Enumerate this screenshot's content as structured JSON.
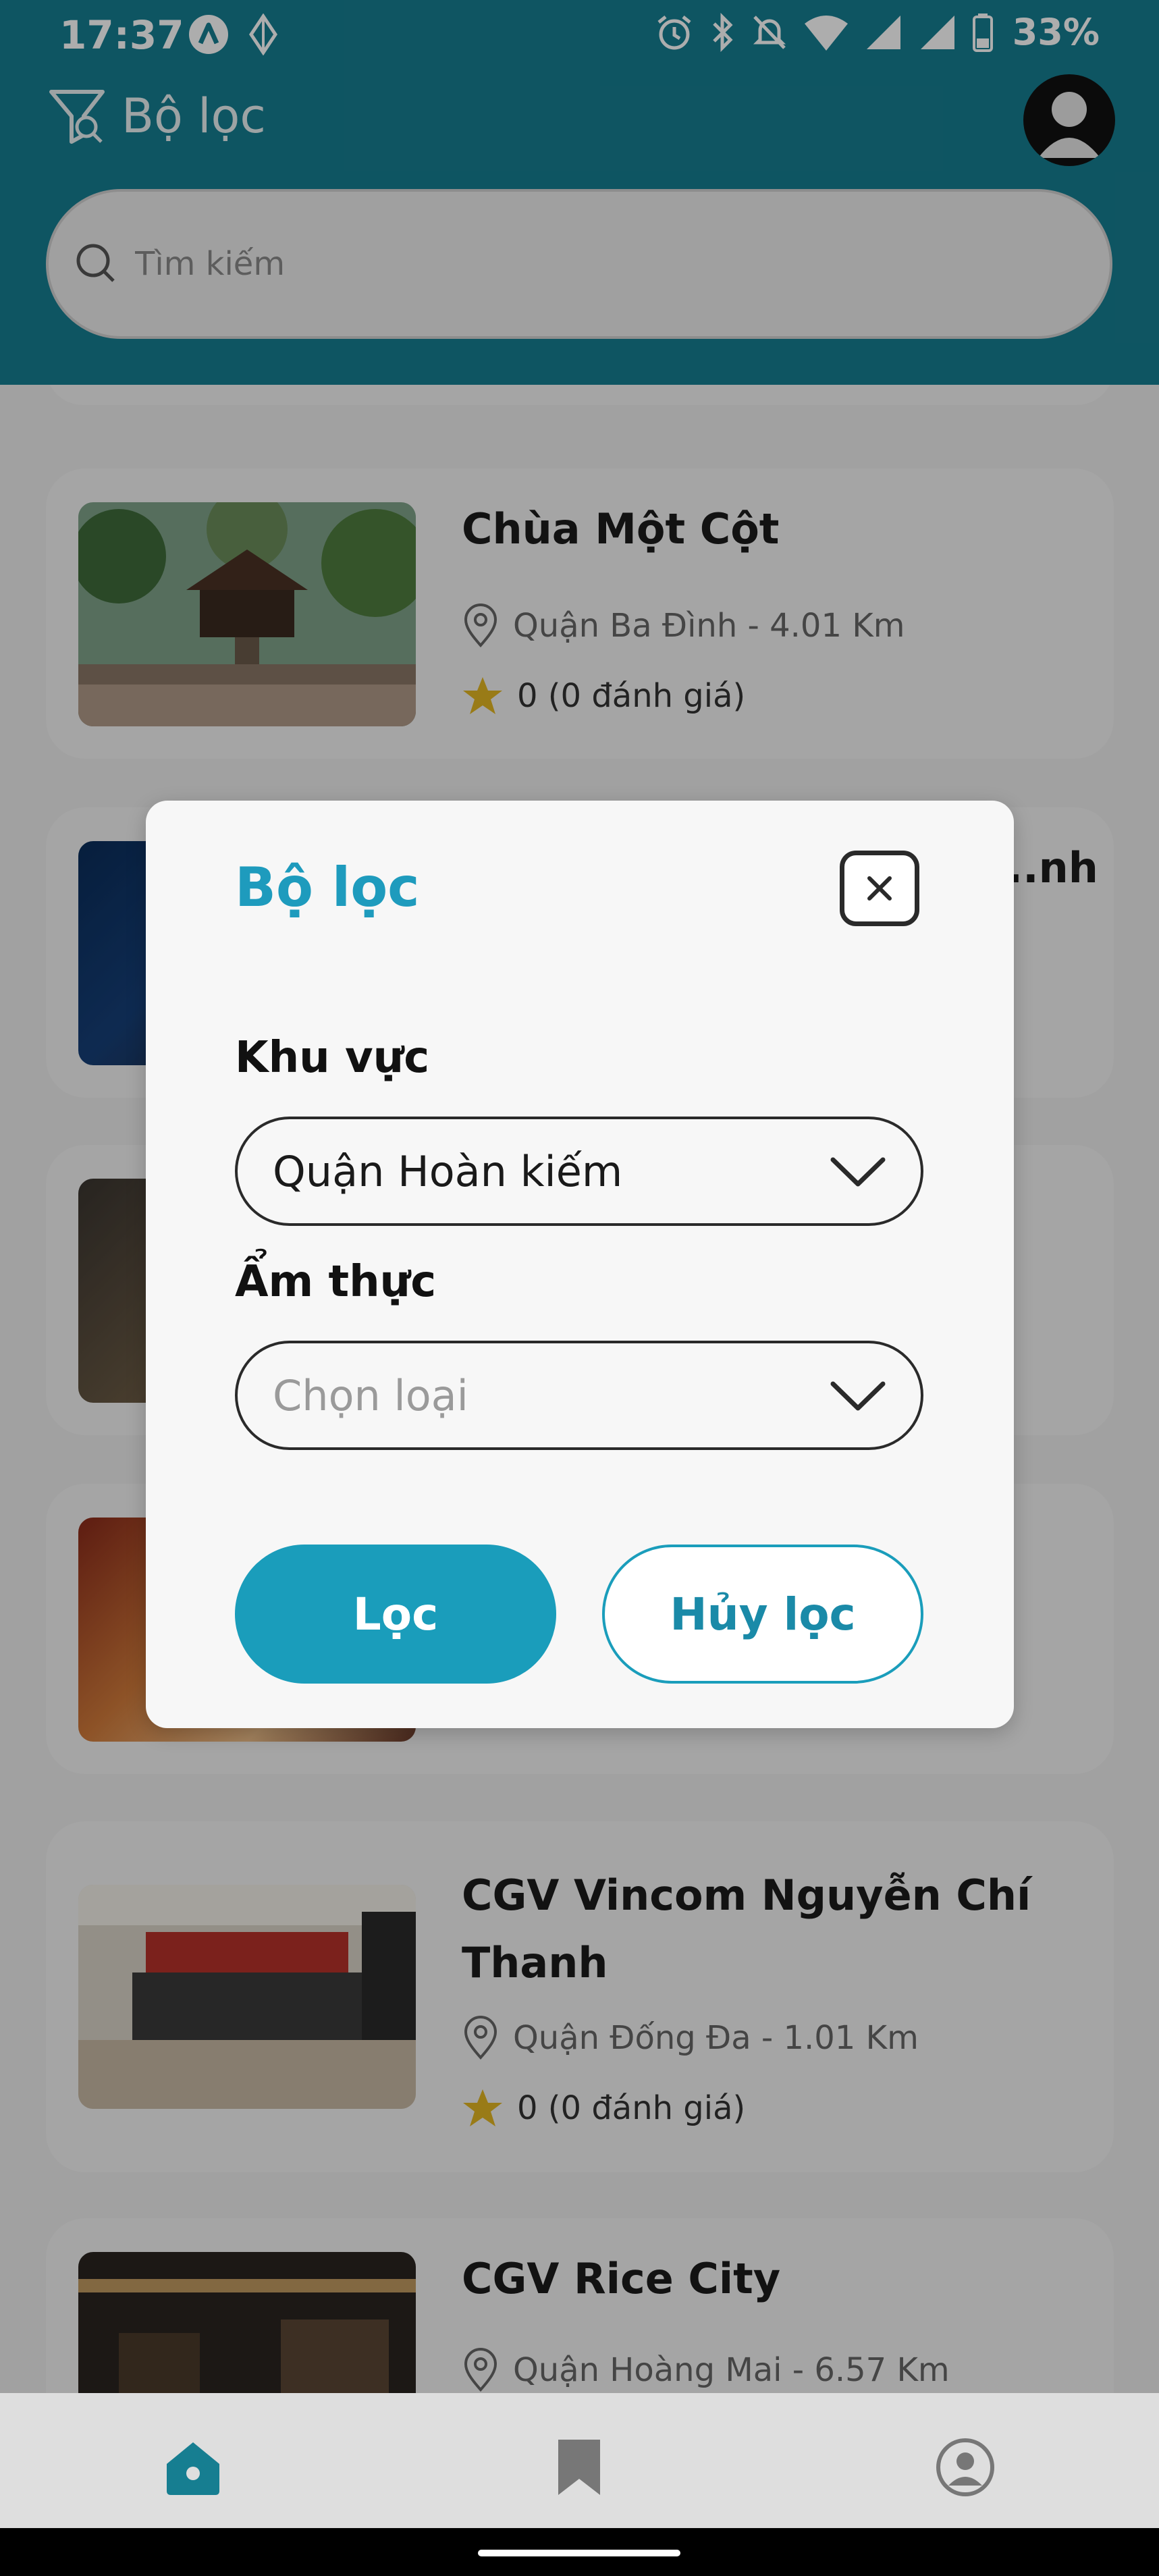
{
  "status_bar": {
    "time": "17:37",
    "battery": "33%",
    "icons": [
      "app-a-icon",
      "drive-icon",
      "alarm-icon",
      "bluetooth-icon",
      "mute-icon",
      "wifi-icon",
      "signal-icon",
      "signal-icon",
      "battery-icon"
    ]
  },
  "header": {
    "title": "Bộ lọc",
    "search_placeholder": "Tìm kiếm"
  },
  "places": [
    {
      "name": "Chùa Một Cột",
      "location": "Quận Ba Đình - 4.01 Km",
      "rating": "0 (0 đánh giá)"
    },
    {
      "name": "...nh",
      "location": "",
      "rating": ""
    },
    {
      "name": "CGV Vincom Nguyễn Chí Thanh",
      "location": "Quận Đống Đa - 1.01 Km",
      "rating": "0 (0 đánh giá)"
    },
    {
      "name": "CGV Rice City",
      "location": "Quận Hoàng Mai - 6.57 Km",
      "rating": ""
    }
  ],
  "modal": {
    "title": "Bộ lọc",
    "area_label": "Khu vực",
    "area_value": "Quận Hoàn kiếm",
    "cuisine_label": "Ẩm thực",
    "cuisine_placeholder": "Chọn loại",
    "filter_button": "Lọc",
    "cancel_button": "Hủy lọc"
  },
  "bottom_nav": {
    "items": [
      "home-icon",
      "bookmark-icon",
      "account-icon"
    ],
    "active": "home-icon"
  },
  "colors": {
    "header": "#167E91",
    "accent": "#1A9DBB",
    "star": "#E2B623"
  }
}
